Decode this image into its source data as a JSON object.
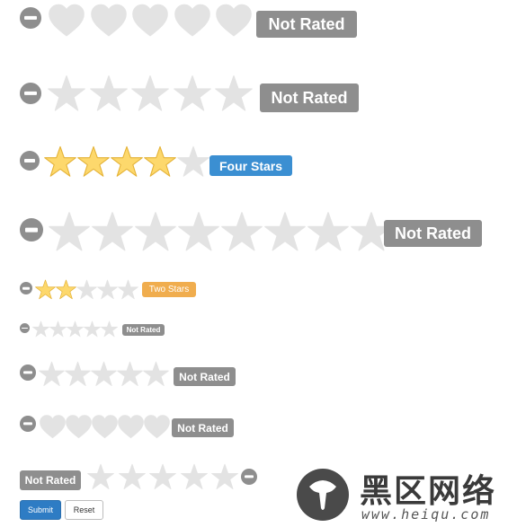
{
  "colors": {
    "empty": "#e3e3e3",
    "filled": "#fdd86c",
    "filled_stroke": "#e4b236",
    "clear": "#8e8e8e"
  },
  "ratings": [
    {
      "symbol": "heart-icon",
      "count": 5,
      "value": 0,
      "badge": {
        "text": "Not Rated",
        "color": "#8e8e8e"
      }
    },
    {
      "symbol": "star-icon",
      "count": 5,
      "value": 0,
      "badge": {
        "text": "Not Rated",
        "color": "#8e8e8e"
      }
    },
    {
      "symbol": "star-icon",
      "count": 5,
      "value": 4,
      "badge": {
        "text": "Four Stars",
        "color": "#3b8fd2"
      }
    },
    {
      "symbol": "star-icon",
      "count": 8,
      "value": 0,
      "badge": {
        "text": "Not Rated",
        "color": "#8e8e8e"
      }
    },
    {
      "symbol": "star-icon",
      "count": 5,
      "value": 2,
      "badge": {
        "text": "Two Stars",
        "color": "#f0ad4e"
      }
    },
    {
      "symbol": "star-icon",
      "count": 5,
      "value": 0,
      "badge": {
        "text": "Not Rated",
        "color": "#8e8e8e"
      }
    },
    {
      "symbol": "star-icon",
      "count": 5,
      "value": 0,
      "badge": {
        "text": "Not Rated",
        "color": "#8e8e8e"
      }
    },
    {
      "symbol": "heart-icon",
      "count": 5,
      "value": 0,
      "badge": {
        "text": "Not Rated",
        "color": "#8e8e8e"
      }
    },
    {
      "symbol": "star-icon",
      "count": 5,
      "value": 0,
      "badge": {
        "text": "Not Rated",
        "color": "#8e8e8e"
      }
    }
  ],
  "form": {
    "submit_label": "Submit",
    "reset_label": "Reset"
  },
  "watermark": {
    "title": "黑区网络",
    "subtitle": "www.heiqu.com",
    "icon": "heiqu-logo"
  }
}
